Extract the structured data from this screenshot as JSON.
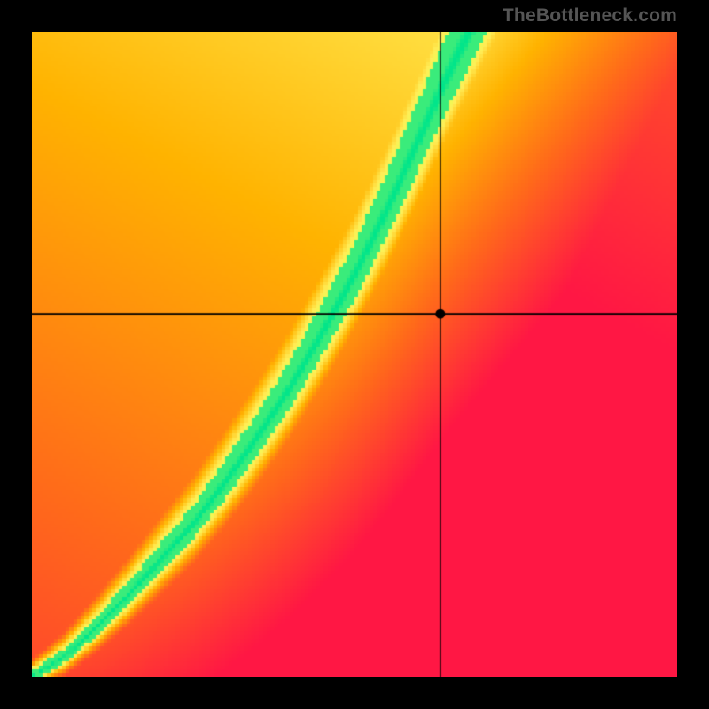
{
  "watermark": "TheBottleneck.com",
  "chart_data": {
    "type": "heatmap",
    "title": "",
    "xlabel": "",
    "ylabel": "",
    "xlim": [
      0,
      1
    ],
    "ylim": [
      0,
      1
    ],
    "grid": false,
    "legend": false,
    "crosshair": {
      "x": 0.633,
      "y": 0.563
    },
    "marker": {
      "x": 0.633,
      "y": 0.563
    },
    "colorscale_stops": [
      {
        "t": 0.0,
        "color": "#ff1744"
      },
      {
        "t": 0.3,
        "color": "#ff6a1a"
      },
      {
        "t": 0.55,
        "color": "#ffb300"
      },
      {
        "t": 0.78,
        "color": "#ffee58"
      },
      {
        "t": 0.92,
        "color": "#e7ff4f"
      },
      {
        "t": 1.0,
        "color": "#00e58a"
      }
    ],
    "ridge": {
      "description": "Optimal y as function of x where score == 1",
      "samples": [
        {
          "x": 0.0,
          "y": 0.0
        },
        {
          "x": 0.05,
          "y": 0.03
        },
        {
          "x": 0.1,
          "y": 0.075
        },
        {
          "x": 0.15,
          "y": 0.125
        },
        {
          "x": 0.2,
          "y": 0.18
        },
        {
          "x": 0.25,
          "y": 0.235
        },
        {
          "x": 0.3,
          "y": 0.3
        },
        {
          "x": 0.35,
          "y": 0.37
        },
        {
          "x": 0.4,
          "y": 0.445
        },
        {
          "x": 0.45,
          "y": 0.53
        },
        {
          "x": 0.5,
          "y": 0.62
        },
        {
          "x": 0.55,
          "y": 0.72
        },
        {
          "x": 0.6,
          "y": 0.83
        },
        {
          "x": 0.65,
          "y": 0.94
        },
        {
          "x": 0.68,
          "y": 1.0
        }
      ]
    },
    "ridge_width": {
      "description": "Approx vertical half-width of the green band (normalized)",
      "samples": [
        {
          "x": 0.0,
          "w": 0.01
        },
        {
          "x": 0.1,
          "w": 0.02
        },
        {
          "x": 0.2,
          "w": 0.03
        },
        {
          "x": 0.3,
          "w": 0.04
        },
        {
          "x": 0.4,
          "w": 0.05
        },
        {
          "x": 0.5,
          "w": 0.06
        },
        {
          "x": 0.6,
          "w": 0.075
        },
        {
          "x": 0.68,
          "w": 0.085
        }
      ]
    }
  }
}
